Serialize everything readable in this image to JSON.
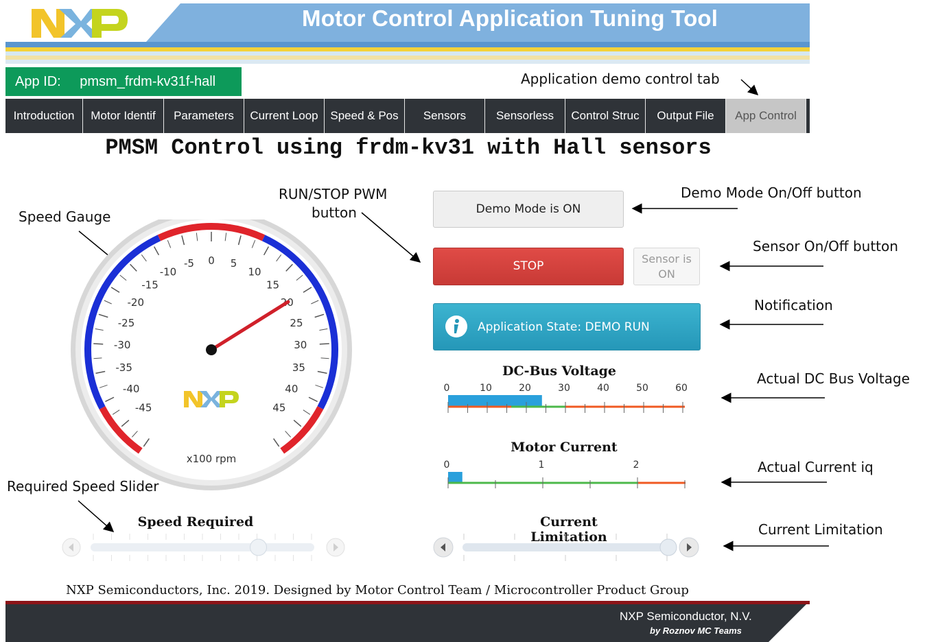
{
  "header": {
    "brand": "NXP",
    "title": "Motor Control Application Tuning Tool"
  },
  "app_id": {
    "label": "App ID:",
    "value": "pmsm_frdm-kv31f-hall"
  },
  "tabs": [
    {
      "label": "Introduction"
    },
    {
      "label": "Motor Identif"
    },
    {
      "label": "Parameters"
    },
    {
      "label": "Current Loop"
    },
    {
      "label": "Speed & Pos"
    },
    {
      "label": "Sensors"
    },
    {
      "label": "Sensorless"
    },
    {
      "label": "Control Struc"
    },
    {
      "label": "Output File"
    },
    {
      "label": "App Control",
      "active": true
    }
  ],
  "page_title": "PMSM Control using frdm-kv31 with Hall sensors",
  "annotations": {
    "app_demo_tab": "Application demo control tab",
    "run_stop_line1": "RUN/STOP PWM",
    "run_stop_line2": "button",
    "speed_gauge": "Speed Gauge",
    "demo_mode_btn": "Demo Mode On/Off button",
    "sensor_btn": "Sensor On/Off button",
    "notification": "Notification",
    "dc_bus": "Actual DC Bus Voltage",
    "current_iq": "Actual Current iq",
    "speed_slider": "Required Speed Slider",
    "current_limitation": "Current Limitation"
  },
  "gauge": {
    "ticks": [
      "-45",
      "-40",
      "-35",
      "-30",
      "-25",
      "-20",
      "-15",
      "-10",
      "-5",
      "0",
      "5",
      "10",
      "15",
      "20",
      "25",
      "30",
      "35",
      "40",
      "45"
    ],
    "unit": "x100 rpm",
    "logo": "NXP",
    "value": 20,
    "min": -50,
    "max": 50,
    "colors": {
      "ring": "#1a2fd6",
      "limit": "#e0242b",
      "needle": "#d0202a"
    }
  },
  "controls": {
    "demo_mode": "Demo Mode is ON",
    "stop": "STOP",
    "sensor_line1": "Sensor is",
    "sensor_line2": "ON",
    "notification": "Application State: DEMO RUN"
  },
  "dc_bus": {
    "title": "DC-Bus Voltage",
    "ticks": [
      "0",
      "10",
      "20",
      "30",
      "40",
      "50",
      "60"
    ],
    "value": 24,
    "max": 60
  },
  "motor_current": {
    "title": "Motor Current",
    "ticks": [
      "0",
      "1",
      "2"
    ],
    "value": 0.15,
    "max": 2.5
  },
  "speed_slider": {
    "title": "Speed Required",
    "value": 0.75
  },
  "current_slider": {
    "title": "Current Limitation",
    "value": 1.0
  },
  "footer": "NXP Semiconductors, Inc. 2019. Designed by Motor Control Team / Microcontroller Product Group",
  "bottom": {
    "company": "NXP Semiconductor, N.V.",
    "team": "by Roznov MC Teams"
  }
}
